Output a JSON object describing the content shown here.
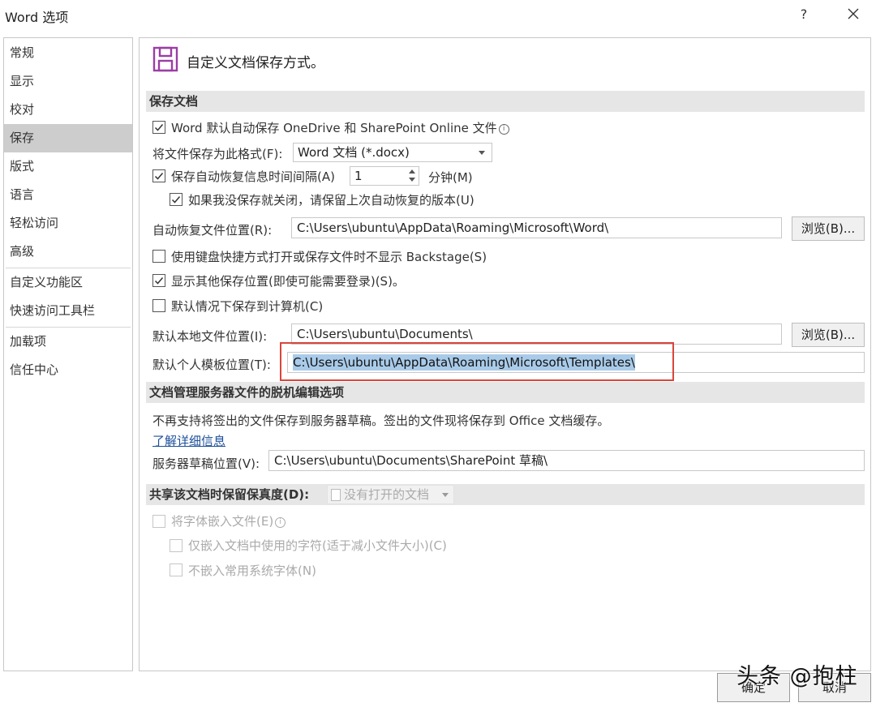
{
  "window": {
    "title": "Word 选项",
    "help": "?",
    "close_icon": "close-icon"
  },
  "sidebar": {
    "items": [
      {
        "label": "常规"
      },
      {
        "label": "显示"
      },
      {
        "label": "校对"
      },
      {
        "label": "保存",
        "active": true
      },
      {
        "label": "版式"
      },
      {
        "label": "语言"
      },
      {
        "label": "轻松访问"
      },
      {
        "label": "高级"
      },
      {
        "label": "自定义功能区"
      },
      {
        "label": "快速访问工具栏"
      },
      {
        "label": "加载项"
      },
      {
        "label": "信任中心"
      }
    ]
  },
  "main": {
    "heading": "自定义文档保存方式。",
    "save_section": {
      "title": "保存文档",
      "onedrive_autosave": {
        "label": "Word 默认自动保存 OneDrive 和 SharePoint Online 文件",
        "checked": true
      },
      "format_label": "将文件保存为此格式(F):",
      "format_value": "Word 文档 (*.docx)",
      "autorecover": {
        "label": "保存自动恢复信息时间间隔(A)",
        "checked": true,
        "value": "1",
        "unit": "分钟(M)"
      },
      "keep_last": {
        "label": "如果我没保存就关闭，请保留上次自动恢复的版本(U)",
        "checked": true
      },
      "autorecover_location_label": "自动恢复文件位置(R):",
      "autorecover_location_value": "C:\\Users\\ubuntu\\AppData\\Roaming\\Microsoft\\Word\\",
      "browse_label": "浏览(B)...",
      "no_backstage": {
        "label": "使用键盘快捷方式打开或保存文件时不显示 Backstage(S)",
        "checked": false
      },
      "show_other": {
        "label": "显示其他保存位置(即使可能需要登录)(S)。",
        "checked": true
      },
      "save_to_computer": {
        "label": "默认情况下保存到计算机(C)",
        "checked": false
      },
      "local_location_label": "默认本地文件位置(I):",
      "local_location_value": "C:\\Users\\ubuntu\\Documents\\",
      "browse_label_2": "浏览(B)...",
      "template_location_label": "默认个人模板位置(T):",
      "template_location_value": "C:\\Users\\ubuntu\\AppData\\Roaming\\Microsoft\\Templates\\"
    },
    "offline_section": {
      "title": "文档管理服务器文件的脱机编辑选项",
      "notice": "不再支持将签出的文件保存到服务器草稿。签出的文件现将保存到 Office 文档缓存。",
      "learn_more": "了解详细信息",
      "drafts_label": "服务器草稿位置(V):",
      "drafts_value": "C:\\Users\\ubuntu\\Documents\\SharePoint 草稿\\"
    },
    "fidelity_section": {
      "title": "共享该文档时保留保真度(D):",
      "doc_select": "没有打开的文档",
      "embed_fonts": {
        "label": "将字体嵌入文件(E)",
        "checked": false
      },
      "embed_used_only": {
        "label": "仅嵌入文档中使用的字符(适于减小文件大小)(C)",
        "checked": false
      },
      "no_common_fonts": {
        "label": "不嵌入常用系统字体(N)",
        "checked": false
      }
    }
  },
  "footer": {
    "ok_label": "确定",
    "cancel_label": "取消"
  },
  "watermark": "头条 @抱柱",
  "colors": {
    "accent_icon": "#9b3ea5",
    "selection": "#a9cbe9",
    "highlight_box": "#d9463c",
    "active_nav": "#cdcdcd"
  }
}
